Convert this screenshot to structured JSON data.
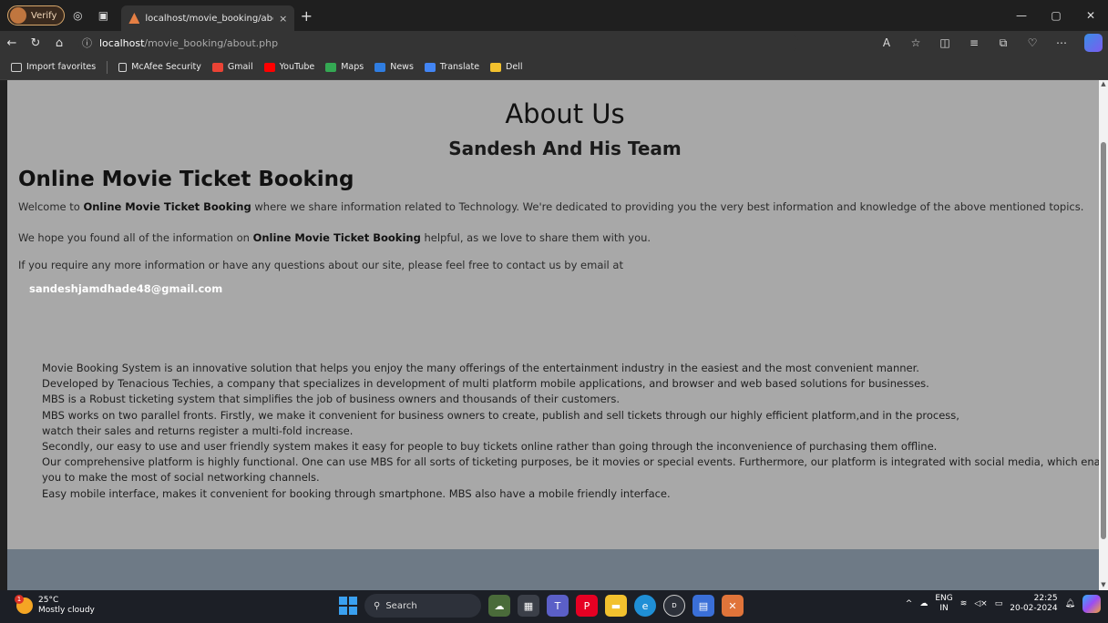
{
  "browser": {
    "verify_label": "Verify",
    "tab_title": "localhost/movie_booking/about.",
    "tab_close": "×",
    "new_tab": "+",
    "url_host": "localhost",
    "url_path": "/movie_booking/about.php",
    "window_controls": [
      "—",
      "▢",
      "✕"
    ],
    "favorites": [
      {
        "label": "Import favorites",
        "color": "#cfcfcf"
      },
      {
        "label": "McAfee Security",
        "color": "#d6d6d6"
      },
      {
        "label": "Gmail",
        "color": "#ea4335"
      },
      {
        "label": "YouTube",
        "color": "#ff0000"
      },
      {
        "label": "Maps",
        "color": "#34a853"
      },
      {
        "label": "News",
        "color": "#2f7de1"
      },
      {
        "label": "Translate",
        "color": "#4285f4"
      },
      {
        "label": "Dell",
        "color": "#f2c12e"
      }
    ]
  },
  "page": {
    "heading": "About Us",
    "subheading": "Sandesh And His Team",
    "section_title": "Online Movie Ticket Booking",
    "para1_a": "Welcome to ",
    "para1_b": "Online Movie Ticket Booking",
    "para1_c": " where we share information related to Technology. We're dedicated to providing you the very best information and knowledge of the above mentioned topics.",
    "para2_a": "We hope you found all of the information on ",
    "para2_b": "Online Movie Ticket Booking",
    "para2_c": " helpful, as we love to share them with you.",
    "para3": "If you require any more information or have any questions about our site, please feel free to contact us by email at",
    "email": "sandeshjamdhade48@gmail.com",
    "description": [
      "Movie Booking System is an innovative solution that helps you enjoy the many offerings of the entertainment industry in the easiest and the most convenient manner.",
      "Developed by Tenacious Techies, a company that specializes in development of multi platform mobile applications, and browser and web based solutions for businesses.",
      "MBS is a Robust ticketing system that simplifies the job of business owners and thousands of their customers.",
      "MBS works on two parallel fronts. Firstly, we make it convenient for business owners to create, publish and sell tickets through our highly efficient platform,and in the process,",
      "watch their sales and returns register a multi-fold increase.",
      "Secondly, our easy to use and user friendly system makes it easy for people to buy tickets online rather than going through the inconvenience of purchasing them offline.",
      "Our comprehensive platform is highly functional. One can use MBS for all sorts of ticketing purposes, be it movies or special events. Furthermore, our platform is integrated with social media, which enables",
      "you to make the most of social networking channels.",
      "Easy mobile interface, makes it convenient for booking through smartphone. MBS also have a mobile friendly interface."
    ]
  },
  "taskbar": {
    "temperature": "25°C",
    "weather": "Mostly cloudy",
    "weather_badge": "1",
    "search_label": "Search",
    "lang_top": "ENG",
    "lang_bottom": "IN",
    "time": "22:25",
    "date": "20-02-2024"
  }
}
